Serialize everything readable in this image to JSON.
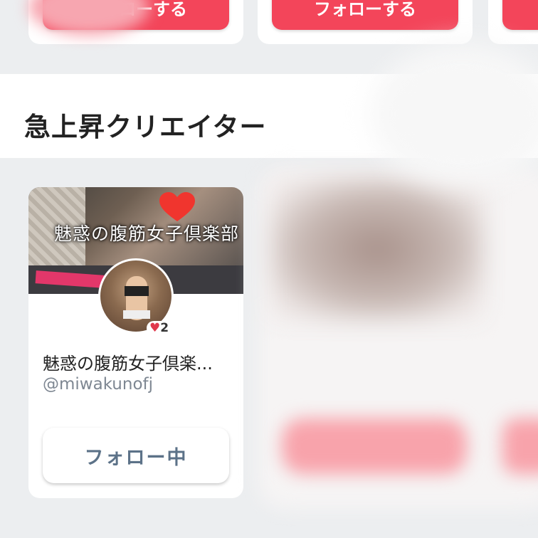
{
  "top_row": {
    "card1_button": "フォローする",
    "card2_button": "フォローする"
  },
  "section": {
    "title": "急上昇クリエイター"
  },
  "creator": {
    "cover_text": "魅惑の腹筋女子倶楽部",
    "name": "魅惑の腹筋女子倶楽...",
    "handle": "@miwakunofj",
    "likes": "2",
    "follow_label": "フォロー中"
  },
  "colors": {
    "follow_red": "#f3455a",
    "following_text": "#5c7288",
    "heart": "#e0384c"
  }
}
